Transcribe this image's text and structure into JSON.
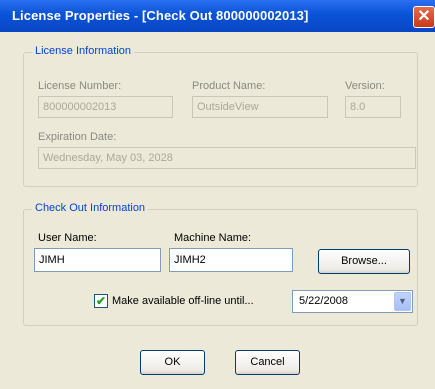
{
  "window": {
    "title": "License Properties - [Check Out 800000002013]",
    "close_glyph": "✕"
  },
  "license_info": {
    "group_title": "License Information",
    "license_number_label": "License Number:",
    "license_number_value": "800000002013",
    "product_name_label": "Product Name:",
    "product_name_value": "OutsideView",
    "version_label": "Version:",
    "version_value": "8.0",
    "expiration_label": "Expiration Date:",
    "expiration_value": "Wednesday, May 03, 2028"
  },
  "checkout_info": {
    "group_title": "Check Out Information",
    "user_name_label": "User Name:",
    "user_name_value": "JIMH",
    "machine_name_label": "Machine Name:",
    "machine_name_value": "JIMH2",
    "browse_label": "Browse...",
    "offline_label": "Make available off-line until...",
    "offline_checked": true,
    "check_glyph": "✔",
    "date_value": "5/22/2008",
    "dropdown_glyph": "▼"
  },
  "buttons": {
    "ok_label": "OK",
    "cancel_label": "Cancel"
  }
}
